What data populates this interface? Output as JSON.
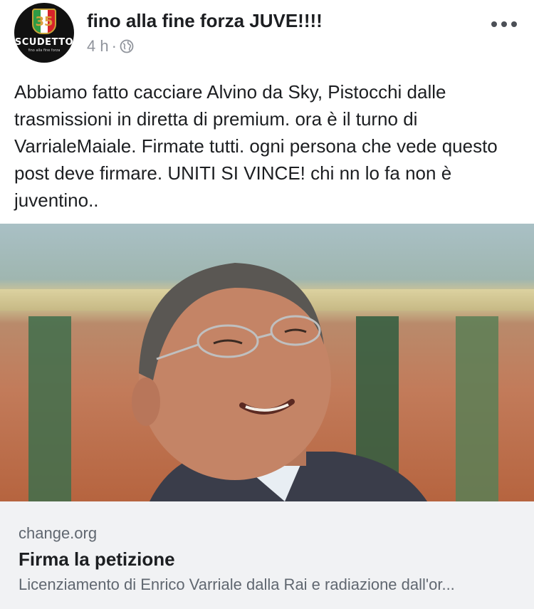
{
  "post": {
    "page_name": "fino alla fine forza JUVE!!!!",
    "time": "4 h",
    "separator": "·",
    "avatar": {
      "badge_text": "SCUDETTO",
      "shield_number": "35",
      "small_text": "fino alla fine forza"
    },
    "text": "Abbiamo fatto cacciare Alvino da Sky, Pistocchi dalle trasmissioni in diretta di premium. ora è il turno di VarrialeMaiale. Firmate tutti. ogni persona che vede questo post deve firmare. UNITI SI VINCE! chi nn lo fa non è juventino..",
    "link": {
      "domain": "change.org",
      "title": "Firma la petizione",
      "description": "Licenziamento di Enrico Varriale dalla Rai e radiazione dall'or..."
    }
  },
  "icons": {
    "globe": "globe-icon",
    "more": "more-options-icon"
  },
  "colors": {
    "text": "#1c1e21",
    "secondary": "#90949c",
    "card_bg": "#f1f2f4"
  }
}
